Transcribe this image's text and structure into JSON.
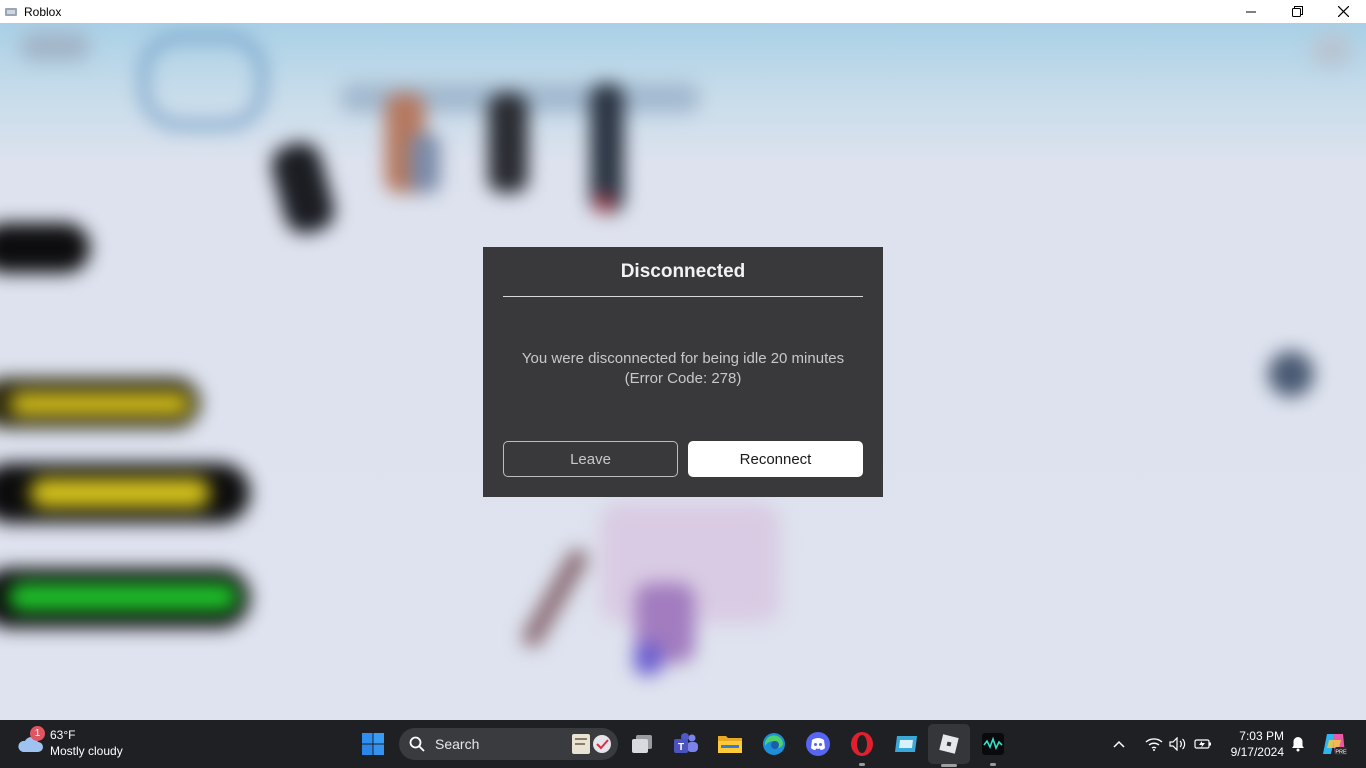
{
  "window": {
    "title": "Roblox"
  },
  "dialog": {
    "title": "Disconnected",
    "message_line1": "You were disconnected for being idle 20 minutes",
    "message_line2": "(Error Code: 278)",
    "leave_label": "Leave",
    "reconnect_label": "Reconnect"
  },
  "taskbar": {
    "weather": {
      "badge": "1",
      "temperature": "63°F",
      "condition": "Mostly cloudy"
    },
    "search": {
      "placeholder": "Search"
    },
    "pinned_apps": [
      "start",
      "task-view",
      "teams",
      "file-explorer",
      "edge",
      "discord",
      "opera",
      "app-bar",
      "roblox",
      "wavelink"
    ],
    "clock": {
      "time": "7:03 PM",
      "date": "9/17/2024"
    }
  },
  "colors": {
    "dialog_bg": "#39393b",
    "reconnect_bg": "#ffffff",
    "taskbar_bg": "#1f2024",
    "accent_blue": "#0078d4"
  }
}
